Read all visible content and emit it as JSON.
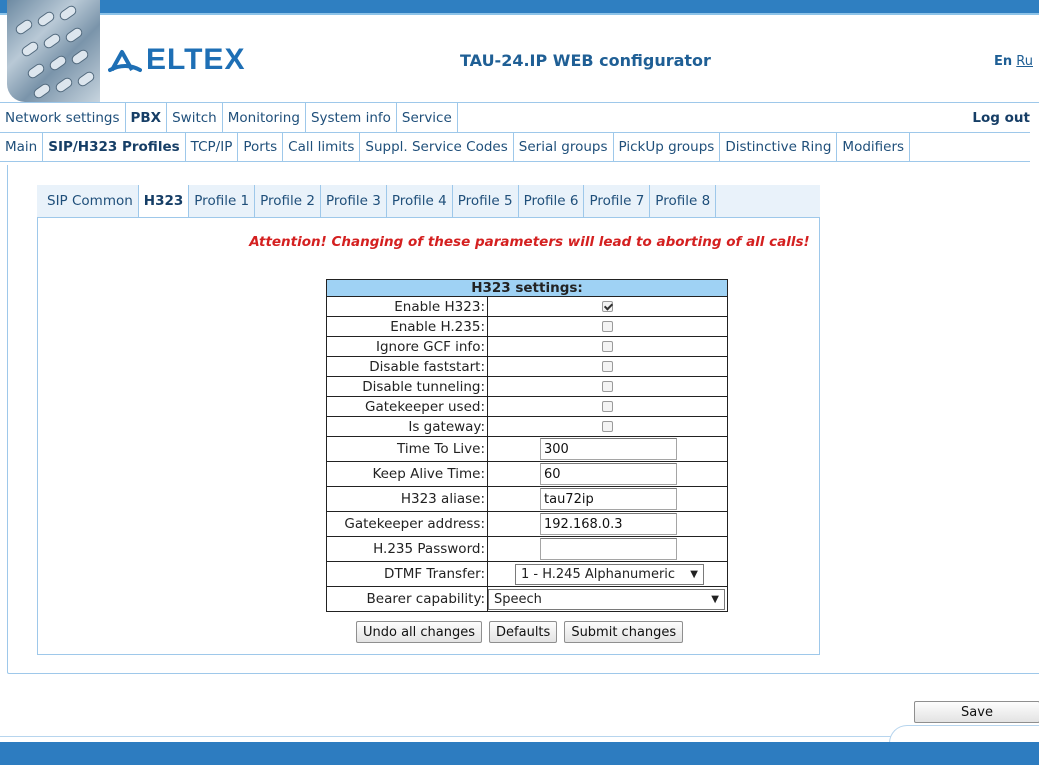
{
  "header": {
    "logo_text": "ELTEX",
    "app_title": "TAU-24.IP WEB configurator",
    "lang_current": "En",
    "lang_other": "Ru",
    "brand_color": "#1e6fb5"
  },
  "main_menu": {
    "items": [
      {
        "label": "Network settings"
      },
      {
        "label": "PBX",
        "active": true
      },
      {
        "label": "Switch"
      },
      {
        "label": "Monitoring"
      },
      {
        "label": "System info"
      },
      {
        "label": "Service"
      }
    ],
    "logout": "Log out"
  },
  "sub_menu": {
    "items": [
      {
        "label": "Main"
      },
      {
        "label": "SIP/H323 Profiles",
        "active": true
      },
      {
        "label": "TCP/IP"
      },
      {
        "label": "Ports"
      },
      {
        "label": "Call limits"
      },
      {
        "label": "Suppl. Service Codes"
      },
      {
        "label": "Serial groups"
      },
      {
        "label": "PickUp groups"
      },
      {
        "label": "Distinctive Ring"
      },
      {
        "label": "Modifiers"
      }
    ]
  },
  "tabs": [
    {
      "label": "SIP Common"
    },
    {
      "label": "H323",
      "active": true
    },
    {
      "label": "Profile 1"
    },
    {
      "label": "Profile 2"
    },
    {
      "label": "Profile 3"
    },
    {
      "label": "Profile 4"
    },
    {
      "label": "Profile 5"
    },
    {
      "label": "Profile 6"
    },
    {
      "label": "Profile 7"
    },
    {
      "label": "Profile 8"
    }
  ],
  "warning": "Attention! Changing of these parameters will lead to aborting of all calls!",
  "h323": {
    "title": "H323 settings:",
    "checkboxes": [
      {
        "label": "Enable H323:",
        "checked": true
      },
      {
        "label": "Enable H.235:",
        "checked": false
      },
      {
        "label": "Ignore GCF info:",
        "checked": false
      },
      {
        "label": "Disable faststart:",
        "checked": false
      },
      {
        "label": "Disable tunneling:",
        "checked": false
      },
      {
        "label": "Gatekeeper used:",
        "checked": false
      },
      {
        "label": "Is gateway:",
        "checked": false
      }
    ],
    "time_to_live": {
      "label": "Time To Live:",
      "value": "300"
    },
    "keep_alive": {
      "label": "Keep Alive Time:",
      "value": "60"
    },
    "aliase": {
      "label": "H323 aliase:",
      "value": "tau72ip"
    },
    "gatekeeper_address": {
      "label": "Gatekeeper address:",
      "value": "192.168.0.3"
    },
    "h235_password": {
      "label": "H.235 Password:",
      "value": ""
    },
    "dtmf_transfer": {
      "label": "DTMF Transfer:",
      "value": "1 - H.245 Alphanumeric"
    },
    "bearer_capability": {
      "label": "Bearer capability:",
      "value": "Speech"
    }
  },
  "buttons": {
    "undo": "Undo all changes",
    "defaults": "Defaults",
    "submit": "Submit changes",
    "save": "Save"
  },
  "icons": {
    "checkbox_checked": "check-mark",
    "select_arrow": "triangle-down"
  }
}
